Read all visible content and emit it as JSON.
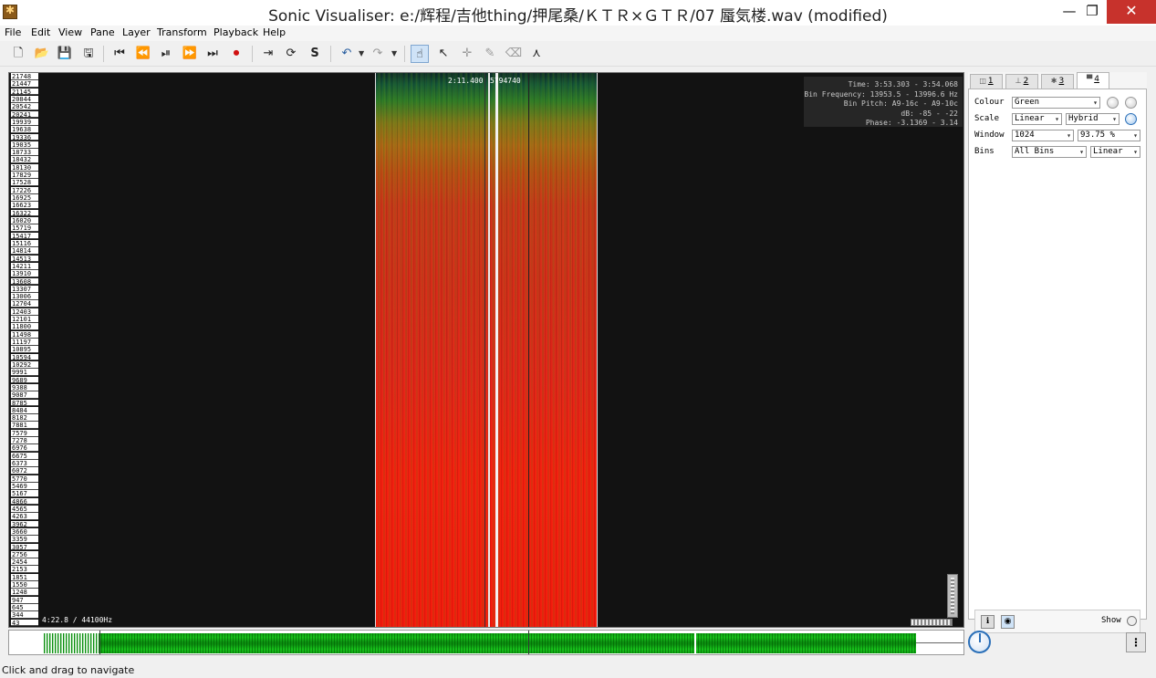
{
  "window": {
    "title": "Sonic Visualiser: e:/辉程/吉他thing/押尾桑/ＫＴＲ×ＧＴＲ/07 蜃気楼.wav (modified)",
    "minimize": "—",
    "maximize": "❐",
    "close": "✕"
  },
  "menu": [
    "File",
    "Edit",
    "View",
    "Pane",
    "Layer",
    "Transform",
    "Playback",
    "Help"
  ],
  "toolbar": {
    "icons": [
      "new-file-icon",
      "open-file-icon",
      "save-icon",
      "save-as-icon",
      "skip-to-start-icon",
      "rewind-icon",
      "play-pause-icon",
      "fast-forward-icon",
      "skip-to-end-icon",
      "record-icon",
      "play-selection-icon",
      "loop-icon",
      "solo-icon",
      "undo-icon",
      "redo-icon",
      "navigate-tool-icon",
      "select-tool-icon",
      "move-tool-icon",
      "draw-tool-icon",
      "erase-tool-icon",
      "measure-tool-icon"
    ],
    "glyphs": [
      "🗋",
      "📂",
      "💾",
      "🖫",
      "⏮",
      "⏪",
      "⏯",
      "⏩",
      "⏭",
      "⏺",
      "⇥",
      "⟳",
      "S",
      "↶",
      "↷",
      "☝",
      "↖",
      "✛",
      "✎",
      "⌫",
      "⋏"
    ]
  },
  "pane": {
    "scale_ticks": [
      "21748",
      "21447",
      "21145",
      "20844",
      "20542",
      "20241",
      "19939",
      "19638",
      "19336",
      "19035",
      "18733",
      "18432",
      "18130",
      "17829",
      "17528",
      "17226",
      "16925",
      "16623",
      "16322",
      "16020",
      "15719",
      "15417",
      "15116",
      "14814",
      "14513",
      "14211",
      "13910",
      "13608",
      "13307",
      "13006",
      "12704",
      "12403",
      "12101",
      "11800",
      "11498",
      "11197",
      "10895",
      "10594",
      "10292",
      "9991",
      "9689",
      "9388",
      "9087",
      "8785",
      "8484",
      "8182",
      "7881",
      "7579",
      "7278",
      "6976",
      "6675",
      "6373",
      "6072",
      "5770",
      "5469",
      "5167",
      "4866",
      "4565",
      "4263",
      "3962",
      "3660",
      "3359",
      "3057",
      "2756",
      "2454",
      "2153",
      "1851",
      "1550",
      "1248",
      "947",
      "645",
      "344",
      "43"
    ],
    "playhead_time": "2:11.400",
    "playhead_frame": "5794740",
    "info": {
      "time": "Time: 3:53.303 - 3:54.068",
      "bin_frequency": "Bin Frequency: 13953.5 - 13996.6 Hz",
      "bin_pitch": "Bin Pitch: A9-16c - A9-10c",
      "db": "dB: -85 - -22",
      "phase": "Phase: -3.1369 - 3.14"
    },
    "footer": "4:22.8 / 44100Hz"
  },
  "props": {
    "tabs": [
      {
        "num": "1",
        "icon": "waveform-tab-icon",
        "glyph": "◫"
      },
      {
        "num": "2",
        "icon": "ruler-tab-icon",
        "glyph": "⊥"
      },
      {
        "num": "3",
        "icon": "waveform-tab-icon",
        "glyph": "✱"
      },
      {
        "num": "4",
        "icon": "spectrogram-tab-icon",
        "glyph": "▀"
      }
    ],
    "colour_label": "Colour",
    "colour_value": "Green",
    "scale_label": "Scale",
    "scale_value": "Linear",
    "scale_mode": "Hybrid",
    "window_label": "Window",
    "window_value": "1024",
    "window_overlap": "93.75 %",
    "bins_label": "Bins",
    "bins_value": "All Bins",
    "bins_scale": "Linear",
    "show_label": "Show"
  },
  "status": {
    "text": "Click and drag to navigate"
  }
}
